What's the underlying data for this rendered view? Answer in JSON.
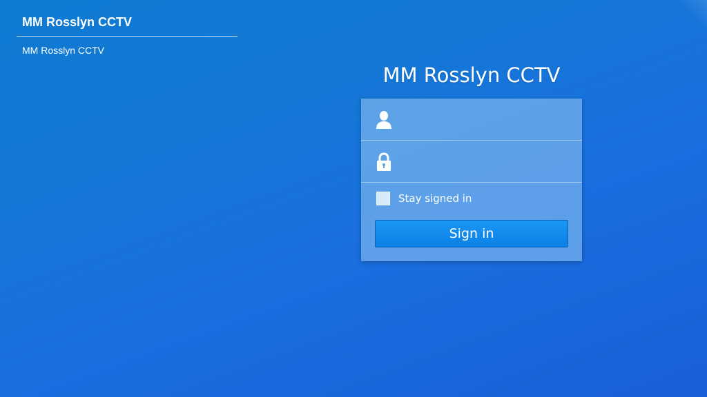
{
  "header": {
    "title": "MM Rosslyn CCTV",
    "subtitle": "MM Rosslyn CCTV"
  },
  "login": {
    "title": "MM Rosslyn CCTV",
    "username": {
      "icon": "user-icon",
      "value": "",
      "placeholder": ""
    },
    "password": {
      "icon": "lock-icon",
      "value": "",
      "placeholder": ""
    },
    "remember_label": "Stay signed in",
    "remember_checked": false,
    "signin_label": "Sign in"
  },
  "colors": {
    "background": "#1478d6",
    "button": "#0b80e6",
    "panel": "#96c8f0"
  }
}
